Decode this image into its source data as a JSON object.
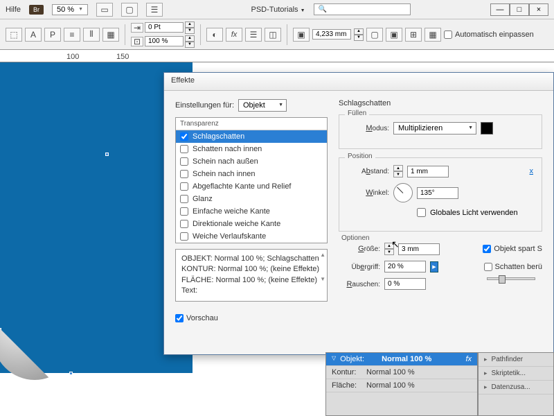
{
  "menubar": {
    "help": "Hilfe",
    "bridge": "Br",
    "zoom": "50 %",
    "tutorials": "PSD-Tutorials"
  },
  "toolbar": {
    "pt_value": "0 Pt",
    "percent_value": "100 %",
    "mm_value": "4,233 mm",
    "auto_fit": "Automatisch einpassen"
  },
  "ruler": {
    "m100": "100",
    "m150": "150"
  },
  "dialog": {
    "title": "Effekte",
    "settings_for": "Einstellungen für:",
    "settings_value": "Objekt",
    "transparency": "Transparenz",
    "effects": [
      "Schlagschatten",
      "Schatten nach innen",
      "Schein nach außen",
      "Schein nach innen",
      "Abgeflachte Kante und Relief",
      "Glanz",
      "Einfache weiche Kante",
      "Direktionale weiche Kante",
      "Weiche Verlaufskante"
    ],
    "summary": {
      "l1": "OBJEKT: Normal 100 %; Schlagschatten",
      "l2": "KONTUR: Normal 100 %; (keine Effekte)",
      "l3": "FLÄCHE: Normal 100 %; (keine Effekte)",
      "l4": "Text:"
    },
    "preview": "Vorschau",
    "heading": "Schlagschatten",
    "fill": {
      "legend": "Füllen",
      "mode": "Modus:",
      "mode_value": "Multiplizieren"
    },
    "position": {
      "legend": "Position",
      "distance": "Abstand:",
      "distance_value": "1 mm",
      "angle": "Winkel:",
      "angle_value": "135°",
      "global_light": "Globales Licht verwenden"
    },
    "options": {
      "legend": "Optionen",
      "size": "Größe:",
      "size_value": "3 mm",
      "spread": "Übergriff:",
      "spread_value": "20 %",
      "noise": "Rauschen:",
      "noise_value": "0 %",
      "object_spares": "Objekt spart S",
      "shadow_touch": "Schatten berü"
    }
  },
  "bottom": {
    "object": "Objekt:",
    "contour": "Kontur:",
    "area": "Fläche:",
    "normal100": "Normal 100 %",
    "pathfinder": "Pathfinder",
    "script": "Skriptetik...",
    "data": "Datenzusa..."
  }
}
